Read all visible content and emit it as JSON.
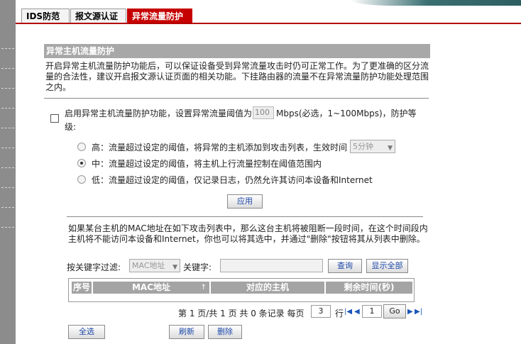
{
  "tabs": [
    {
      "label": "IDS防范",
      "active": false
    },
    {
      "label": "报文源认证",
      "active": false
    },
    {
      "label": "异常流量防护",
      "active": true
    }
  ],
  "section": {
    "title": "异常主机流量防护",
    "description": "开启异常主机流量防护功能后，可以保证设备受到异常流量攻击时仍可正常工作。为了更准确的区分流量的合法性，建议开启报文源认证页面的相关功能。下挂路由器的流量不在异常流量防护功能处理范围之内。"
  },
  "enable": {
    "label_prefix": "启用异常主机流量防护功能，设置异常流量阈值为",
    "threshold_value": "100",
    "label_suffix": "Mbps(必选，1~100Mbps)，防护等",
    "label_wrap": "级:",
    "checked": false
  },
  "levels": [
    {
      "label": "高：流量超过设定的阈值，将异常的主机添加到攻击列表，生效时间",
      "selected": false
    },
    {
      "label": "中：流量超过设定的阈值，将主机上行流量控制在阈值范围内",
      "selected": true
    },
    {
      "label": "低：流量超过设定的阈值，仅记录日志，仍然允许其访问本设备和Internet",
      "selected": false
    }
  ],
  "effect_time": {
    "value": "5分钟"
  },
  "apply_button": "应用",
  "attack_desc": "如果某台主机的MAC地址在如下攻击列表中，那么这台主机将被阻断一段时间，在这个时间段内主机将不能访问本设备和Internet，你也可以将其选中，并通过\"删除\"按钮将其从列表中删除。",
  "filter": {
    "label": "按关键字过滤:",
    "field_value": "MAC地址",
    "keyword_label": "关键字:",
    "keyword_value": "",
    "query_button": "查询",
    "show_all_button": "显示全部"
  },
  "table": {
    "columns": [
      "序号",
      "MAC地址",
      "对应的主机",
      "剩余时间(秒)"
    ],
    "sort_indicator": "↑",
    "rows": []
  },
  "pager": {
    "summary": "第 1 页/共 1 页 共 0 条记录 每页",
    "per_page": "3",
    "rows_suffix": "行",
    "page": "1",
    "go_button": "Go"
  },
  "actions": {
    "select_all": "全选",
    "refresh": "刷新",
    "delete": "删除"
  },
  "colors": {
    "active_tab": "#c60000",
    "header_gray": "#a8a8a8",
    "button_text": "#1c47a8"
  }
}
